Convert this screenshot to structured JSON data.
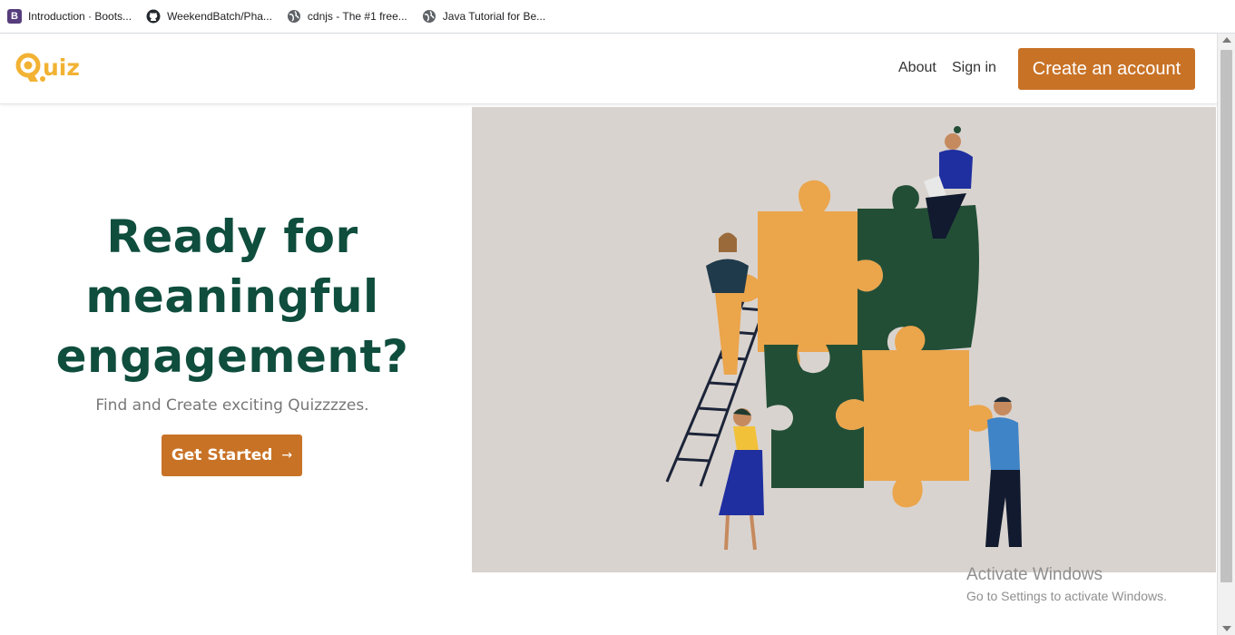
{
  "bookmarks": [
    {
      "label": "Introduction · Boots...",
      "icon": "bootstrap-icon"
    },
    {
      "label": "WeekendBatch/Pha...",
      "icon": "github-icon"
    },
    {
      "label": "cdnjs - The #1 free...",
      "icon": "globe-icon"
    },
    {
      "label": "Java Tutorial for Be...",
      "icon": "globe-icon"
    }
  ],
  "nav": {
    "logo_text": "Quiz",
    "about": "About",
    "signin": "Sign in",
    "create_account": "Create an account"
  },
  "hero": {
    "headline": "Ready for meaningful engagement?",
    "subline": "Find and Create exciting Quizzzzes.",
    "cta": "Get Started",
    "cta_arrow": "→"
  },
  "watermark": {
    "title": "Activate Windows",
    "subtitle": "Go to Settings to activate Windows."
  },
  "colors": {
    "accent": "#c87226",
    "heading": "#0f4d3d",
    "logo": "#f2b233",
    "illustration_bg": "#d9d3cf",
    "puzzle_orange": "#eba54b",
    "puzzle_green": "#234e36"
  }
}
